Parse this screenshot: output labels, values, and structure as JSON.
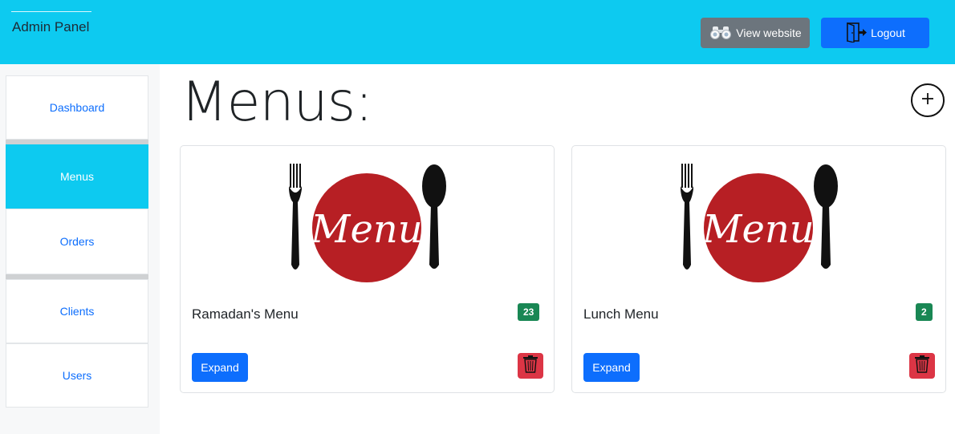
{
  "header": {
    "brand": "Admin Panel",
    "view_website_label": "View website",
    "logout_label": "Logout"
  },
  "sidebar": {
    "items": [
      {
        "label": "Dashboard",
        "active": false
      },
      {
        "label": "Menus",
        "active": true
      },
      {
        "label": "Orders",
        "active": false
      },
      {
        "label": "Clients",
        "active": false
      },
      {
        "label": "Users",
        "active": false
      }
    ]
  },
  "main": {
    "title": "Menus:",
    "add_icon": "plus-circle-icon",
    "cards": [
      {
        "title": "Ramadan's Menu",
        "count": "23",
        "image_text": "Menu",
        "expand_label": "Expand",
        "delete_icon": "trash-icon"
      },
      {
        "title": "Lunch Menu",
        "count": "2",
        "image_text": "Menu",
        "expand_label": "Expand",
        "delete_icon": "trash-icon"
      }
    ]
  },
  "colors": {
    "header": "#0dcaf0",
    "primary": "#0d6efd",
    "secondary": "#6c757d",
    "success": "#198754",
    "danger": "#dc3545",
    "menu_logo": "#b71f24"
  }
}
